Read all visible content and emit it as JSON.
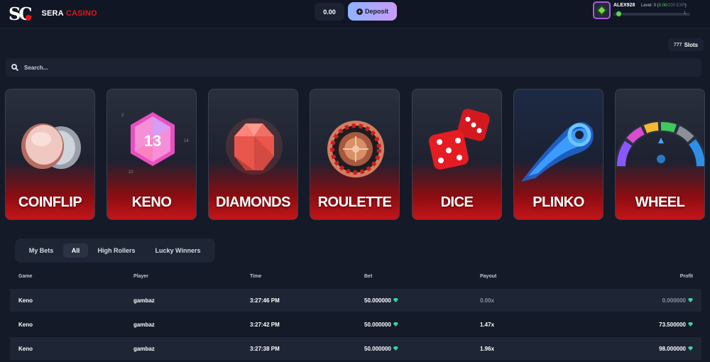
{
  "header": {
    "logo_mark": "SC",
    "brand_sera": "SERA",
    "brand_casino": "CASINO",
    "balance": "0.00",
    "deposit_label": "Deposit",
    "user": {
      "username": "ALEX928",
      "level_label": "Level: 0",
      "xp_current": "0.00",
      "xp_total": "/200 EXP",
      "xp_progress": 0,
      "next_level": "1"
    }
  },
  "slots_label": "Slots",
  "search": {
    "placeholder": "Search..."
  },
  "games": [
    {
      "name": "COINFLIP",
      "icon": "coin-icon"
    },
    {
      "name": "KENO",
      "icon": "keno-gem-icon",
      "number": "13"
    },
    {
      "name": "DIAMONDS",
      "icon": "diamond-icon"
    },
    {
      "name": "ROULETTE",
      "icon": "roulette-wheel-icon"
    },
    {
      "name": "DICE",
      "icon": "dice-icon"
    },
    {
      "name": "PLINKO",
      "icon": "fireball-icon"
    },
    {
      "name": "WHEEL",
      "icon": "wheel-icon"
    }
  ],
  "tabs": [
    {
      "label": "My Bets",
      "active": false
    },
    {
      "label": "All",
      "active": true
    },
    {
      "label": "High Rollers",
      "active": false
    },
    {
      "label": "Lucky Winners",
      "active": false
    }
  ],
  "table": {
    "columns": [
      "Game",
      "Player",
      "Time",
      "Bet",
      "Payout",
      "Profit"
    ],
    "rows": [
      {
        "game": "Keno",
        "player": "gambaz",
        "time": "3:27:46 PM",
        "bet": "50.000000",
        "payout": "0.00x",
        "profit": "0.000000"
      },
      {
        "game": "Keno",
        "player": "gambaz",
        "time": "3:27:42 PM",
        "bet": "50.000000",
        "payout": "1.47x",
        "profit": "73.500000"
      },
      {
        "game": "Keno",
        "player": "gambaz",
        "time": "3:27:38 PM",
        "bet": "50.000000",
        "payout": "1.96x",
        "profit": "98.000000"
      }
    ]
  },
  "colors": {
    "accent_red": "#e0161b",
    "gem_green": "#3ecf9c",
    "xp_green": "#5dd35a"
  }
}
